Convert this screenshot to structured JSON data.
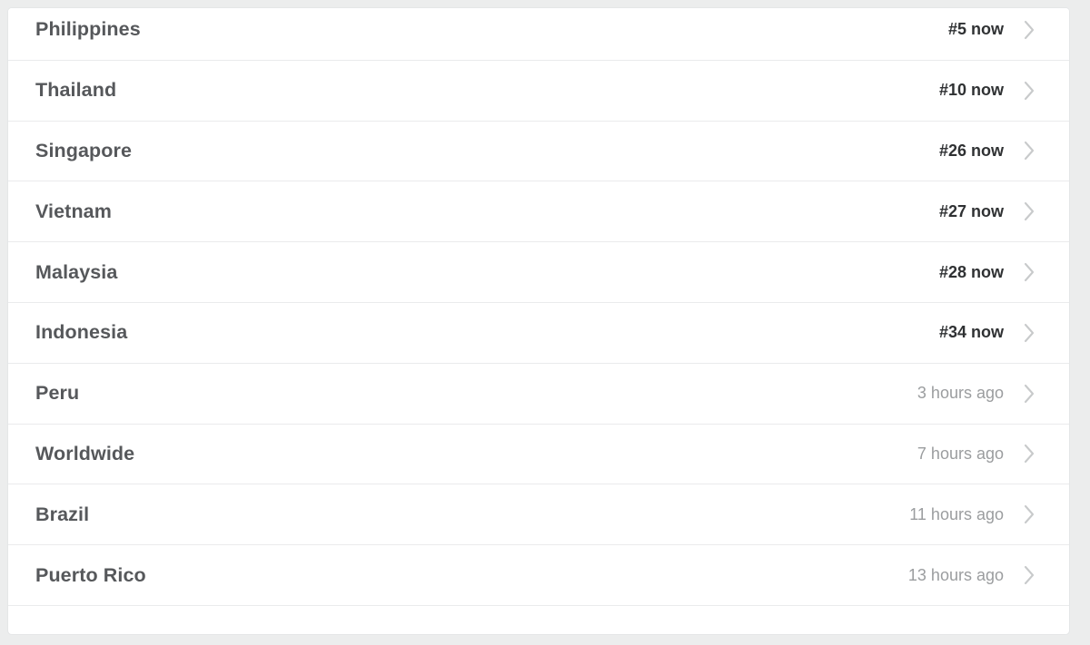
{
  "card": {
    "name": "trending-locations-list"
  },
  "list": {
    "rows": [
      {
        "name": "Philippines",
        "meta": "#5 now",
        "meta_type": "rank",
        "chevron": "chevron-right-icon"
      },
      {
        "name": "Thailand",
        "meta": "#10 now",
        "meta_type": "rank",
        "chevron": "chevron-right-icon"
      },
      {
        "name": "Singapore",
        "meta": "#26 now",
        "meta_type": "rank",
        "chevron": "chevron-right-icon"
      },
      {
        "name": "Vietnam",
        "meta": "#27 now",
        "meta_type": "rank",
        "chevron": "chevron-right-icon"
      },
      {
        "name": "Malaysia",
        "meta": "#28 now",
        "meta_type": "rank",
        "chevron": "chevron-right-icon"
      },
      {
        "name": "Indonesia",
        "meta": "#34 now",
        "meta_type": "rank",
        "chevron": "chevron-right-icon"
      },
      {
        "name": "Peru",
        "meta": "3 hours ago",
        "meta_type": "ago",
        "chevron": "chevron-right-icon"
      },
      {
        "name": "Worldwide",
        "meta": "7 hours ago",
        "meta_type": "ago",
        "chevron": "chevron-right-icon"
      },
      {
        "name": "Brazil",
        "meta": "11 hours ago",
        "meta_type": "ago",
        "chevron": "chevron-right-icon"
      },
      {
        "name": "Puerto Rico",
        "meta": "13 hours ago",
        "meta_type": "ago",
        "chevron": "chevron-right-icon"
      }
    ]
  },
  "colors": {
    "page_background": "#eceded",
    "card_background": "#ffffff",
    "card_border": "#e4e6e7",
    "row_divider": "#eaebec",
    "name_text": "#56585b",
    "rank_text": "#2f3133",
    "ago_text": "#9b9d9f",
    "chevron": "#c8cacb"
  }
}
